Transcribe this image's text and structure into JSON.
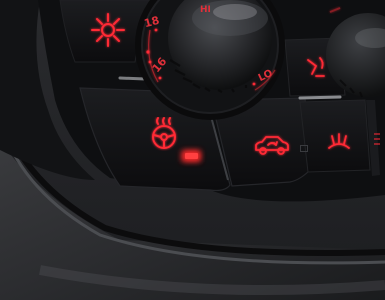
{
  "scene": {
    "subject": "car-climate-control-panel",
    "backlight_color": "#ff2a36",
    "indicator_on_color": "#ff3a3a"
  },
  "temperature_dial": {
    "labels": [
      "18",
      "16",
      "LO",
      "HI"
    ]
  },
  "buttons": [
    {
      "name": "rear-defrost-button",
      "icon": "defrost-icon"
    },
    {
      "name": "steering-wheel-heat-button",
      "icon": "steering-wheel-heat-icon",
      "indicator": "on"
    },
    {
      "name": "air-recirculation-button",
      "icon": "car-recirculation-icon"
    },
    {
      "name": "airflow-mode-button",
      "icon": "airflow-icon"
    },
    {
      "name": "windshield-defrost-button",
      "icon": "windshield-defrost-icon"
    }
  ]
}
